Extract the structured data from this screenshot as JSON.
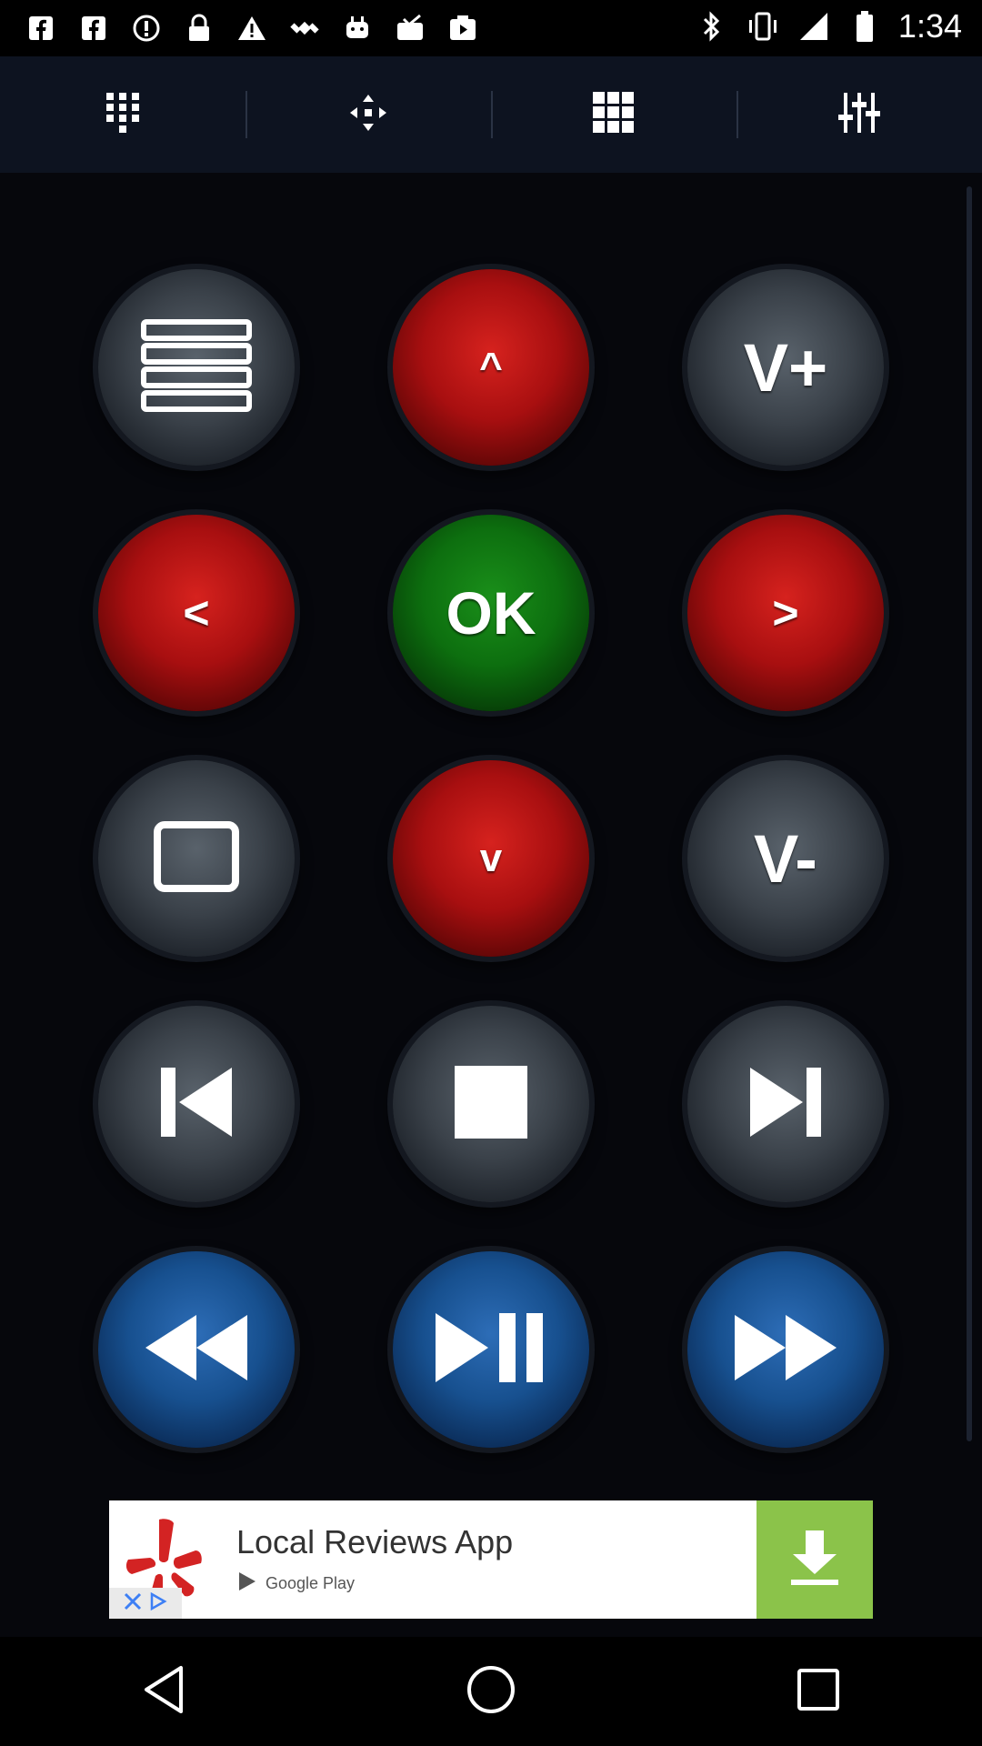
{
  "status_bar": {
    "time": "1:34",
    "left_icons": [
      "facebook-icon",
      "facebook-icon",
      "alert-circle-icon",
      "lock-icon",
      "warning-icon",
      "satellite-icon",
      "android-icon",
      "check-box-icon",
      "play-store-icon"
    ],
    "right_icons": [
      "bluetooth-icon",
      "vibrate-icon",
      "signal-icon",
      "battery-icon"
    ]
  },
  "toolbar": {
    "items": [
      "numpad-icon",
      "dpad-icon",
      "grid-icon",
      "settings-sliders-icon"
    ]
  },
  "remote": {
    "buttons": [
      {
        "name": "menu-button",
        "color": "gray",
        "label": "",
        "icon": "menu-lines-icon"
      },
      {
        "name": "up-button",
        "color": "red",
        "label": "^",
        "icon": ""
      },
      {
        "name": "volume-up-button",
        "color": "gray",
        "label": "V+",
        "icon": ""
      },
      {
        "name": "left-button",
        "color": "red",
        "label": "<",
        "icon": ""
      },
      {
        "name": "ok-button",
        "color": "green",
        "label": "OK",
        "icon": ""
      },
      {
        "name": "right-button",
        "color": "red",
        "label": ">",
        "icon": ""
      },
      {
        "name": "screen-button",
        "color": "gray",
        "label": "",
        "icon": "square-outline-icon"
      },
      {
        "name": "down-button",
        "color": "red",
        "label": "v",
        "icon": ""
      },
      {
        "name": "volume-down-button",
        "color": "gray",
        "label": "V-",
        "icon": ""
      },
      {
        "name": "previous-button",
        "color": "gray",
        "label": "",
        "icon": "skip-previous-icon"
      },
      {
        "name": "stop-button",
        "color": "gray",
        "label": "",
        "icon": "stop-icon"
      },
      {
        "name": "next-button",
        "color": "gray",
        "label": "",
        "icon": "skip-next-icon"
      },
      {
        "name": "rewind-button",
        "color": "blue",
        "label": "",
        "icon": "rewind-icon"
      },
      {
        "name": "play-pause-button",
        "color": "blue",
        "label": "",
        "icon": "play-pause-icon"
      },
      {
        "name": "fast-forward-button",
        "color": "blue",
        "label": "",
        "icon": "fast-forward-icon"
      }
    ]
  },
  "ad": {
    "title": "Local Reviews App",
    "store": "Google Play",
    "accent": "#8bc34a",
    "brand_color": "#d32323"
  },
  "nav": {
    "items": [
      "back-icon",
      "home-icon",
      "recents-icon"
    ]
  }
}
